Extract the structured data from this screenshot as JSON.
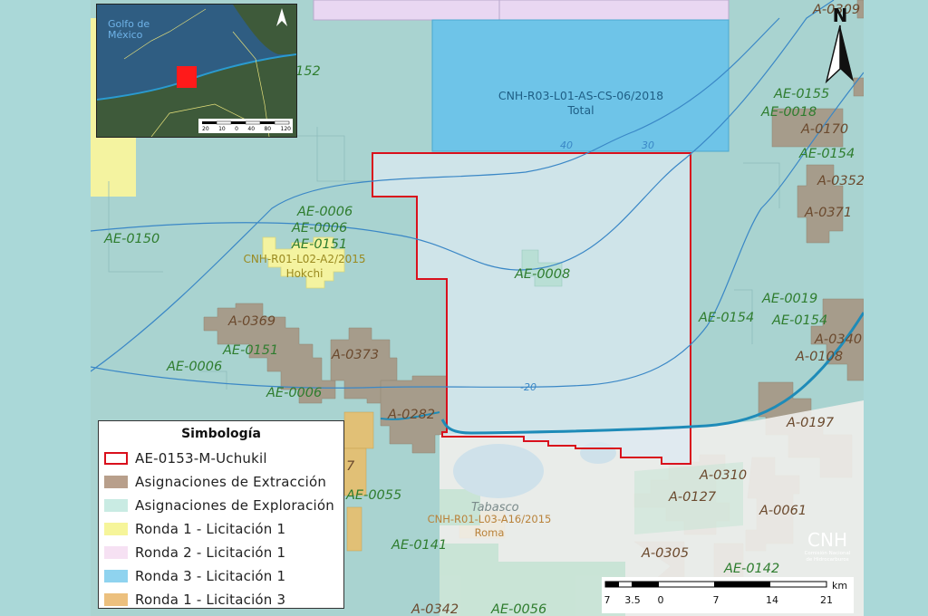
{
  "map": {
    "north_letter": "N",
    "colors": {
      "sea": "#a9d3d0",
      "ronda3_block": "#6ec4e8",
      "ronda2_block": "#e9d7f2",
      "ronda1_l1": "#f4f3a0",
      "ronda1_l3": "#e8bf6d",
      "extraction": "#a69784",
      "exploration": "#b9dfd5",
      "aoi_outline": "#d9101c",
      "coast": "#1e8bb8"
    },
    "labels": {
      "ronda3_block_name": "CNH-R03-L01-AS-CS-06/2018",
      "ronda3_block_sub": "Total",
      "hokchi_name": "CNH-R01-L02-A2/2015",
      "hokchi_sub": "Hokchi",
      "roma_name": "CNH-R01-L03-A16/2015",
      "roma_sub": "Roma",
      "state": "Tabasco",
      "contour_40": "40",
      "contour_30": "30",
      "contour_20": "-20",
      "ae_0152": "152",
      "ae_0155": "AE-0155",
      "ae_0018": "AE-0018",
      "ae_0154_top": "AE-0154",
      "ae_0150": "AE-0150",
      "ae_0006_a": "AE-0006",
      "ae_0006_b": "AE-0006",
      "ae_0151_a": "AE-0151",
      "ae_0008": "AE-0008",
      "ae_0019": "AE-0019",
      "ae_0154_mid": "AE-0154",
      "ae_0154_right": "AE-0154",
      "ae_0151_b": "AE-0151",
      "ae_0006_c": "AE-0006",
      "ae_0006_d": "AE-0006",
      "ae_0055": "AE-0055",
      "ae_0141": "AE-0141",
      "ae_0142": "AE-0142",
      "ae_0056": "AE-0056",
      "a_0309": "A-0309",
      "a_0170": "A-0170",
      "a_0352": "A-0352",
      "a_0371": "A-0371",
      "a_0369": "A-0369",
      "a_0373": "A-0373",
      "a_0282": "A-0282",
      "a_0340": "A-0340",
      "a_0108": "A-0108",
      "a_0197": "A-0197",
      "a_0310": "A-0310",
      "a_0127": "A-0127",
      "a_0061": "A-0061",
      "a_0305": "A-0305",
      "a_0342": "A-0342",
      "partial_7": "7"
    }
  },
  "inset": {
    "title": "Golfo de\nMéxico",
    "scale_ticks": [
      "20",
      "10",
      "0",
      "40",
      "80",
      "120"
    ],
    "colors": {
      "land": "#3e5a3a",
      "sea": "#2f5d82",
      "coast": "#2a9bd0",
      "aoi": "#ff1a1a"
    }
  },
  "legend": {
    "title": "Simbología",
    "items": [
      {
        "label": "AE-0153-M-Uchukil",
        "fill": "#ffffff",
        "stroke": "#d9101c"
      },
      {
        "label": "Asignaciones de Extracción",
        "fill": "#b89f8b",
        "stroke": "#b89f8b"
      },
      {
        "label": "Asignaciones de Exploración",
        "fill": "#c9ebe3",
        "stroke": "#c9ebe3"
      },
      {
        "label": "Ronda 1 - Licitación 1",
        "fill": "#f6f59a",
        "stroke": "#f6f59a"
      },
      {
        "label": "Ronda 2 - Licitación 1",
        "fill": "#f6e1f3",
        "stroke": "#f6e1f3"
      },
      {
        "label": "Ronda 3 - Licitación 1",
        "fill": "#8fd3ef",
        "stroke": "#8fd3ef"
      },
      {
        "label": "Ronda 1 - Licitación 3",
        "fill": "#ecc07e",
        "stroke": "#ecc07e"
      }
    ]
  },
  "logo": {
    "name": "CNH",
    "subtitle": "Comisión Nacional\nde Hidrocarburos"
  },
  "scalebar": {
    "ticks": [
      "7",
      "3.5",
      "0",
      "7",
      "14",
      "21"
    ],
    "unit": "km"
  }
}
